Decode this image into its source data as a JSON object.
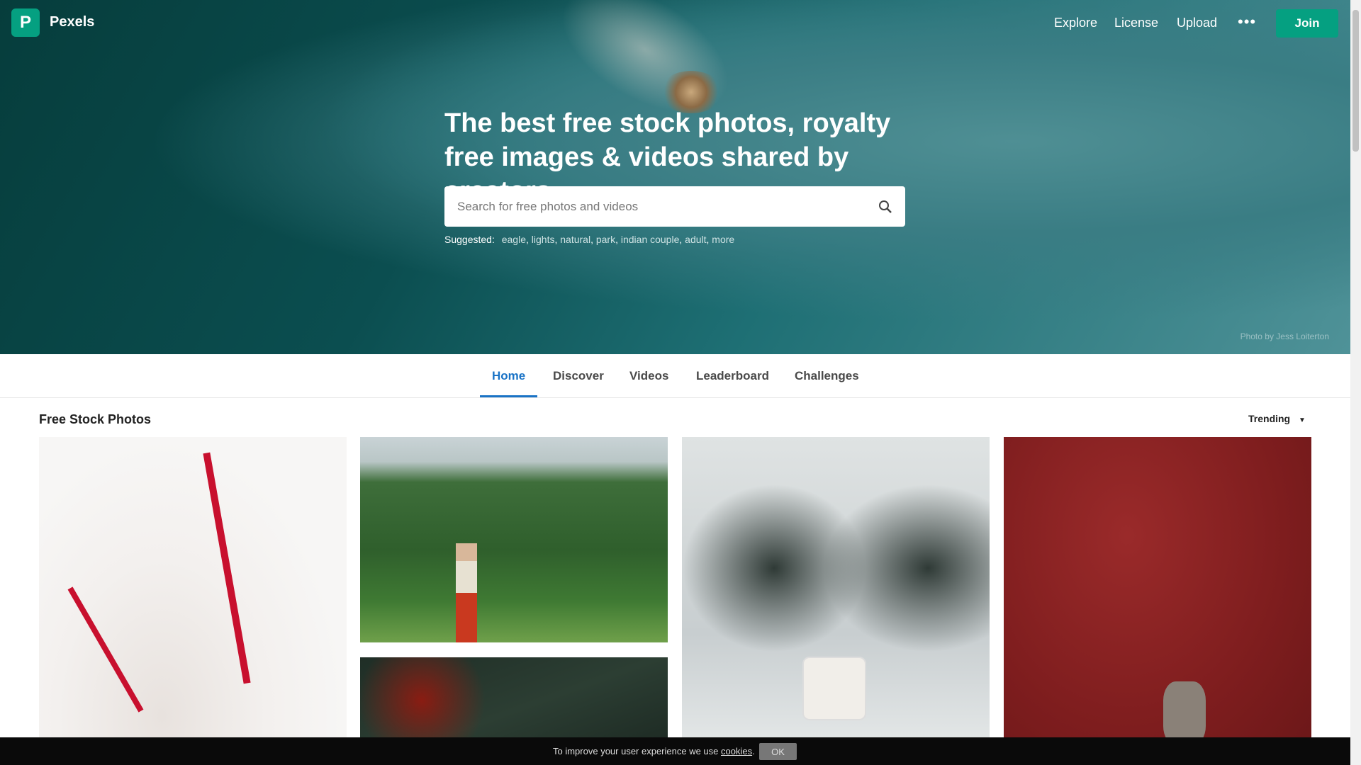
{
  "header": {
    "brand": "Pexels",
    "logo_letter": "P",
    "nav": [
      "Explore",
      "License",
      "Upload"
    ],
    "more_icon": "•••",
    "join_label": "Join",
    "accent": "#05a081"
  },
  "hero": {
    "headline": "The best free stock photos, royalty free images & videos shared by creators.",
    "search_placeholder": "Search for free photos and videos",
    "suggested_label": "Suggested:",
    "suggestions": [
      "eagle",
      "lights",
      "natural",
      "park",
      "indian couple",
      "adult",
      "more"
    ],
    "credit": "Photo by Jess Loiterton"
  },
  "tabs": [
    {
      "label": "Home",
      "active": true
    },
    {
      "label": "Discover"
    },
    {
      "label": "Videos"
    },
    {
      "label": "Leaderboard"
    },
    {
      "label": "Challenges"
    }
  ],
  "gallery": {
    "title": "Free Stock Photos",
    "sort": "Trending"
  },
  "cookie": {
    "text": "To improve your user experience we use ",
    "link": "cookies",
    "end": ".",
    "ok": "OK"
  }
}
